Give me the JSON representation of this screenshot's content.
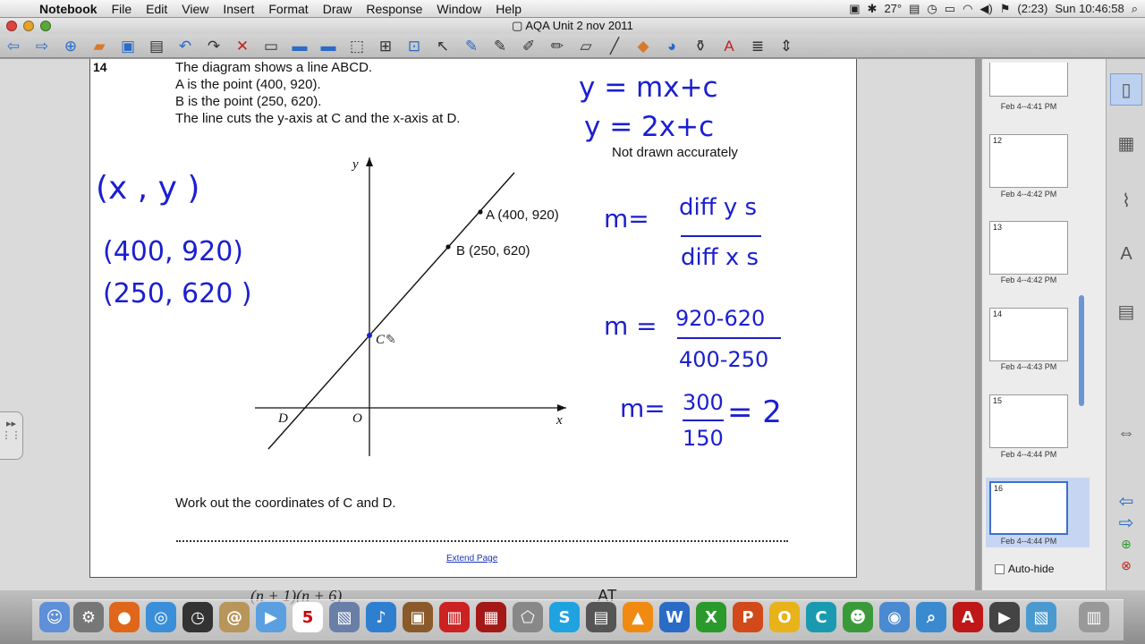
{
  "menubar": {
    "apple_icon": "apple-icon",
    "app_name": "Notebook",
    "items": [
      "File",
      "Edit",
      "View",
      "Insert",
      "Format",
      "Draw",
      "Response",
      "Window",
      "Help"
    ],
    "battery": "(2:23)",
    "temperature": "27°",
    "clock": "Sun 10:46:58"
  },
  "window": {
    "title": "AQA Unit 2 nov 2011"
  },
  "page": {
    "question_number": "14",
    "line1": "The diagram shows a line ABCD.",
    "line2": "A is the point (400, 920).",
    "line3": "B is the point (250, 620).",
    "line4": "The line cuts the y-axis at C and the x-axis at D.",
    "note": "Not drawn accurately",
    "prompt": "Work out the coordinates of C and D.",
    "extend_link": "Extend Page",
    "diagram": {
      "label_a": "A (400, 920)",
      "label_b": "B (250, 620)",
      "label_c": "C",
      "label_d": "D",
      "label_o": "O",
      "label_x": "x",
      "label_y": "y"
    },
    "handwriting": {
      "eq1": "y = mx+c",
      "eq2": "y = 2x+c",
      "xy": "(x , y )",
      "p1": "(400, 920)",
      "p2": "(250, 620 )",
      "m_def_lhs": "m=",
      "m_def_num": "diff y s",
      "m_def_den": "diff x s",
      "m2_lhs": "m =",
      "m2_num": "920-620",
      "m2_den": "400-250",
      "m3_lhs": "m=",
      "m3_num": "300",
      "m3_den": "150",
      "m3_result": "= 2"
    }
  },
  "sorter": {
    "pages": [
      {
        "number": "",
        "label": "Feb 4--4:41 PM"
      },
      {
        "number": "12",
        "label": "Feb 4--4:42 PM"
      },
      {
        "number": "13",
        "label": "Feb 4--4:42 PM"
      },
      {
        "number": "14",
        "label": "Feb 4--4:43 PM"
      },
      {
        "number": "15",
        "label": "Feb 4--4:44 PM"
      },
      {
        "number": "16",
        "label": "Feb 4--4:44 PM"
      }
    ],
    "autohide_label": "Auto-hide"
  },
  "dock_visible_text": {
    "calendar_day": "5",
    "behind_text_left": "(n + 1)(n + 6)",
    "behind_text_right": "AT"
  },
  "colors": {
    "ink_blue": "#1b1fd0",
    "selection": "#c6d6f2"
  }
}
